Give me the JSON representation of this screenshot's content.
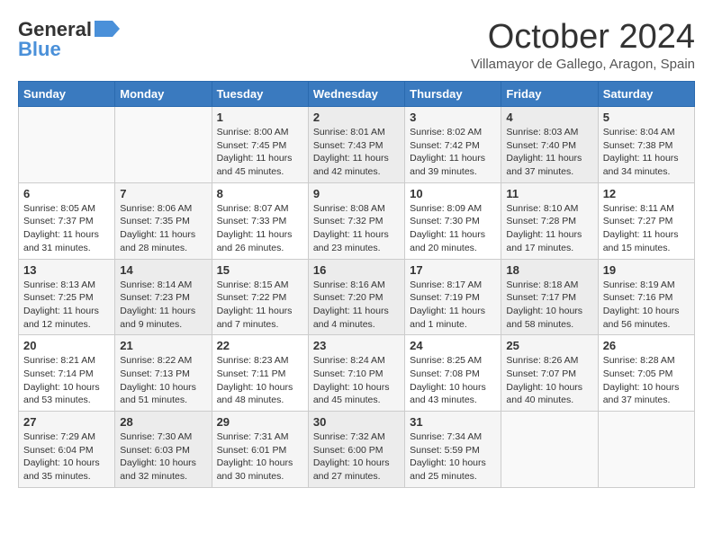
{
  "header": {
    "logo_line1": "General",
    "logo_line2": "Blue",
    "month": "October 2024",
    "location": "Villamayor de Gallego, Aragon, Spain"
  },
  "weekdays": [
    "Sunday",
    "Monday",
    "Tuesday",
    "Wednesday",
    "Thursday",
    "Friday",
    "Saturday"
  ],
  "weeks": [
    [
      {
        "day": "",
        "info": ""
      },
      {
        "day": "",
        "info": ""
      },
      {
        "day": "1",
        "info": "Sunrise: 8:00 AM\nSunset: 7:45 PM\nDaylight: 11 hours and 45 minutes."
      },
      {
        "day": "2",
        "info": "Sunrise: 8:01 AM\nSunset: 7:43 PM\nDaylight: 11 hours and 42 minutes."
      },
      {
        "day": "3",
        "info": "Sunrise: 8:02 AM\nSunset: 7:42 PM\nDaylight: 11 hours and 39 minutes."
      },
      {
        "day": "4",
        "info": "Sunrise: 8:03 AM\nSunset: 7:40 PM\nDaylight: 11 hours and 37 minutes."
      },
      {
        "day": "5",
        "info": "Sunrise: 8:04 AM\nSunset: 7:38 PM\nDaylight: 11 hours and 34 minutes."
      }
    ],
    [
      {
        "day": "6",
        "info": "Sunrise: 8:05 AM\nSunset: 7:37 PM\nDaylight: 11 hours and 31 minutes."
      },
      {
        "day": "7",
        "info": "Sunrise: 8:06 AM\nSunset: 7:35 PM\nDaylight: 11 hours and 28 minutes."
      },
      {
        "day": "8",
        "info": "Sunrise: 8:07 AM\nSunset: 7:33 PM\nDaylight: 11 hours and 26 minutes."
      },
      {
        "day": "9",
        "info": "Sunrise: 8:08 AM\nSunset: 7:32 PM\nDaylight: 11 hours and 23 minutes."
      },
      {
        "day": "10",
        "info": "Sunrise: 8:09 AM\nSunset: 7:30 PM\nDaylight: 11 hours and 20 minutes."
      },
      {
        "day": "11",
        "info": "Sunrise: 8:10 AM\nSunset: 7:28 PM\nDaylight: 11 hours and 17 minutes."
      },
      {
        "day": "12",
        "info": "Sunrise: 8:11 AM\nSunset: 7:27 PM\nDaylight: 11 hours and 15 minutes."
      }
    ],
    [
      {
        "day": "13",
        "info": "Sunrise: 8:13 AM\nSunset: 7:25 PM\nDaylight: 11 hours and 12 minutes."
      },
      {
        "day": "14",
        "info": "Sunrise: 8:14 AM\nSunset: 7:23 PM\nDaylight: 11 hours and 9 minutes."
      },
      {
        "day": "15",
        "info": "Sunrise: 8:15 AM\nSunset: 7:22 PM\nDaylight: 11 hours and 7 minutes."
      },
      {
        "day": "16",
        "info": "Sunrise: 8:16 AM\nSunset: 7:20 PM\nDaylight: 11 hours and 4 minutes."
      },
      {
        "day": "17",
        "info": "Sunrise: 8:17 AM\nSunset: 7:19 PM\nDaylight: 11 hours and 1 minute."
      },
      {
        "day": "18",
        "info": "Sunrise: 8:18 AM\nSunset: 7:17 PM\nDaylight: 10 hours and 58 minutes."
      },
      {
        "day": "19",
        "info": "Sunrise: 8:19 AM\nSunset: 7:16 PM\nDaylight: 10 hours and 56 minutes."
      }
    ],
    [
      {
        "day": "20",
        "info": "Sunrise: 8:21 AM\nSunset: 7:14 PM\nDaylight: 10 hours and 53 minutes."
      },
      {
        "day": "21",
        "info": "Sunrise: 8:22 AM\nSunset: 7:13 PM\nDaylight: 10 hours and 51 minutes."
      },
      {
        "day": "22",
        "info": "Sunrise: 8:23 AM\nSunset: 7:11 PM\nDaylight: 10 hours and 48 minutes."
      },
      {
        "day": "23",
        "info": "Sunrise: 8:24 AM\nSunset: 7:10 PM\nDaylight: 10 hours and 45 minutes."
      },
      {
        "day": "24",
        "info": "Sunrise: 8:25 AM\nSunset: 7:08 PM\nDaylight: 10 hours and 43 minutes."
      },
      {
        "day": "25",
        "info": "Sunrise: 8:26 AM\nSunset: 7:07 PM\nDaylight: 10 hours and 40 minutes."
      },
      {
        "day": "26",
        "info": "Sunrise: 8:28 AM\nSunset: 7:05 PM\nDaylight: 10 hours and 37 minutes."
      }
    ],
    [
      {
        "day": "27",
        "info": "Sunrise: 7:29 AM\nSunset: 6:04 PM\nDaylight: 10 hours and 35 minutes."
      },
      {
        "day": "28",
        "info": "Sunrise: 7:30 AM\nSunset: 6:03 PM\nDaylight: 10 hours and 32 minutes."
      },
      {
        "day": "29",
        "info": "Sunrise: 7:31 AM\nSunset: 6:01 PM\nDaylight: 10 hours and 30 minutes."
      },
      {
        "day": "30",
        "info": "Sunrise: 7:32 AM\nSunset: 6:00 PM\nDaylight: 10 hours and 27 minutes."
      },
      {
        "day": "31",
        "info": "Sunrise: 7:34 AM\nSunset: 5:59 PM\nDaylight: 10 hours and 25 minutes."
      },
      {
        "day": "",
        "info": ""
      },
      {
        "day": "",
        "info": ""
      }
    ]
  ]
}
